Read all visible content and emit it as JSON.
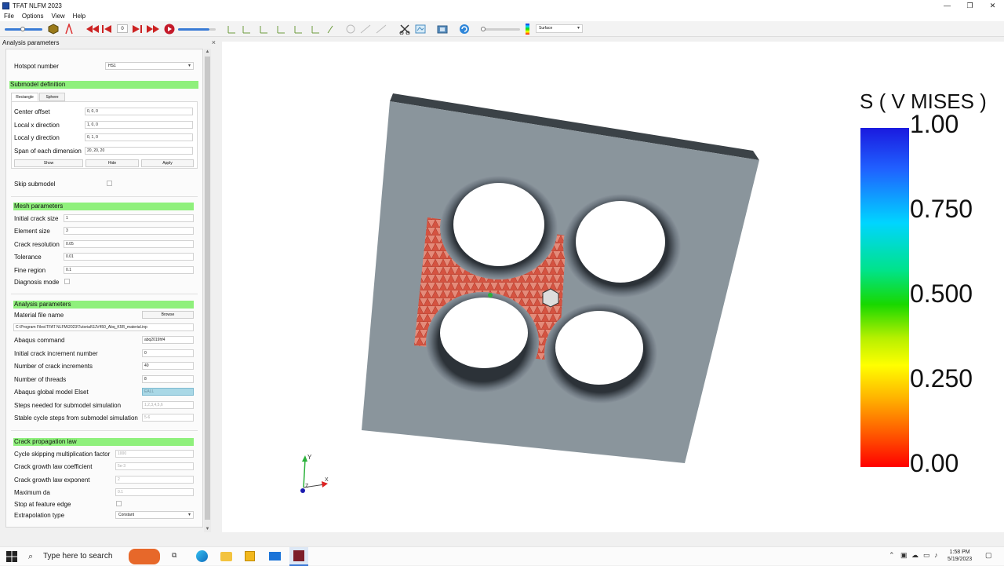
{
  "window": {
    "title": "TFAT NLFM 2023",
    "controls": {
      "minimize": "—",
      "maximize": "❐",
      "close": "✕"
    }
  },
  "menu": {
    "file": "File",
    "options": "Options",
    "view": "View",
    "help": "Help"
  },
  "toolbar": {
    "frame_value": "0",
    "display_mode": "Surface",
    "icons": [
      "slider",
      "shield-icon",
      "crack-icon",
      "rewind-icon",
      "step-back-icon",
      "play-icon",
      "fast-forward-icon",
      "record-icon",
      "axes-icons",
      "cut-icon",
      "view-icon",
      "camera-icon",
      "refresh-icon",
      "color-map-icon"
    ]
  },
  "panel": {
    "title": "Analysis parameters",
    "hotspot": {
      "label": "Hotspot number",
      "value": "HS1"
    },
    "submodel": {
      "header": "Submodel definition",
      "tabs": [
        "Rectangle",
        "Sphere"
      ],
      "center_offset": {
        "label": "Center offset",
        "value": "0, 0, 0"
      },
      "local_x": {
        "label": "Local x direction",
        "value": "1, 0, 0"
      },
      "local_y": {
        "label": "Local y direction",
        "value": "0, 1, 0"
      },
      "span": {
        "label": "Span of each dimension",
        "value": "20, 20, 20"
      },
      "buttons": {
        "show": "Show",
        "hide": "Hide",
        "apply": "Apply"
      }
    },
    "skip_submodel": {
      "label": "Skip submodel"
    },
    "mesh": {
      "header": "Mesh parameters",
      "initial_crack_size": {
        "label": "Initial crack size",
        "value": "1"
      },
      "element_size": {
        "label": "Element size",
        "value": "3"
      },
      "crack_resolution": {
        "label": "Crack resolution",
        "value": "0.05"
      },
      "tolerance": {
        "label": "Tolerance",
        "value": "0.01"
      },
      "fine_region": {
        "label": "Fine region",
        "value": "0.1"
      },
      "diagnosis_mode": {
        "label": "Diagnosis mode"
      }
    },
    "analysis": {
      "header": "Analysis parameters",
      "material_file": {
        "label": "Material file name",
        "button": "Browse",
        "path": "C:\\Program Files\\TFAT NLFM\\2023\\Tutorial\\SJV450_Abq_K5R_material.inp"
      },
      "abaqus_command": {
        "label": "Abaqus command",
        "value": "abq2019hf4"
      },
      "initial_increment": {
        "label": "Initial crack increment number",
        "value": "0"
      },
      "num_increments": {
        "label": "Number of crack increments",
        "value": "40"
      },
      "threads": {
        "label": "Number of threads",
        "value": "8"
      },
      "elset": {
        "label": "Abaqus global model Elset",
        "value": "EALL"
      },
      "steps_needed": {
        "label": "Steps needed for submodel simulation",
        "value": "1,2,3,4,5,6"
      },
      "stable_steps": {
        "label": "Stable cycle steps from submodel simulation",
        "value": "5-6"
      }
    },
    "crack_law": {
      "header": "Crack propagation law",
      "cycle_skipping": {
        "label": "Cycle skipping multiplication factor",
        "value": "1000"
      },
      "coefficient": {
        "label": "Crack growth law coefficient",
        "value": "5e-3"
      },
      "exponent": {
        "label": "Crack growth law exponent",
        "value": "2"
      },
      "max_da": {
        "label": "Maximum da",
        "value": "0.1"
      },
      "stop_feature": {
        "label": "Stop at feature edge"
      },
      "extrapolation": {
        "label": "Extrapolation type",
        "value": "Constant"
      }
    }
  },
  "viewport": {
    "legend": {
      "title": "S ( V MISES )",
      "ticks": [
        "1.00",
        "0.750",
        "0.500",
        "0.250",
        "0.00"
      ]
    },
    "triad": {
      "y": "Y",
      "z": "Z",
      "x": "X"
    }
  },
  "taskbar": {
    "search_placeholder": "Type here to search",
    "time": "1:58 PM",
    "date": "5/19/2023"
  }
}
